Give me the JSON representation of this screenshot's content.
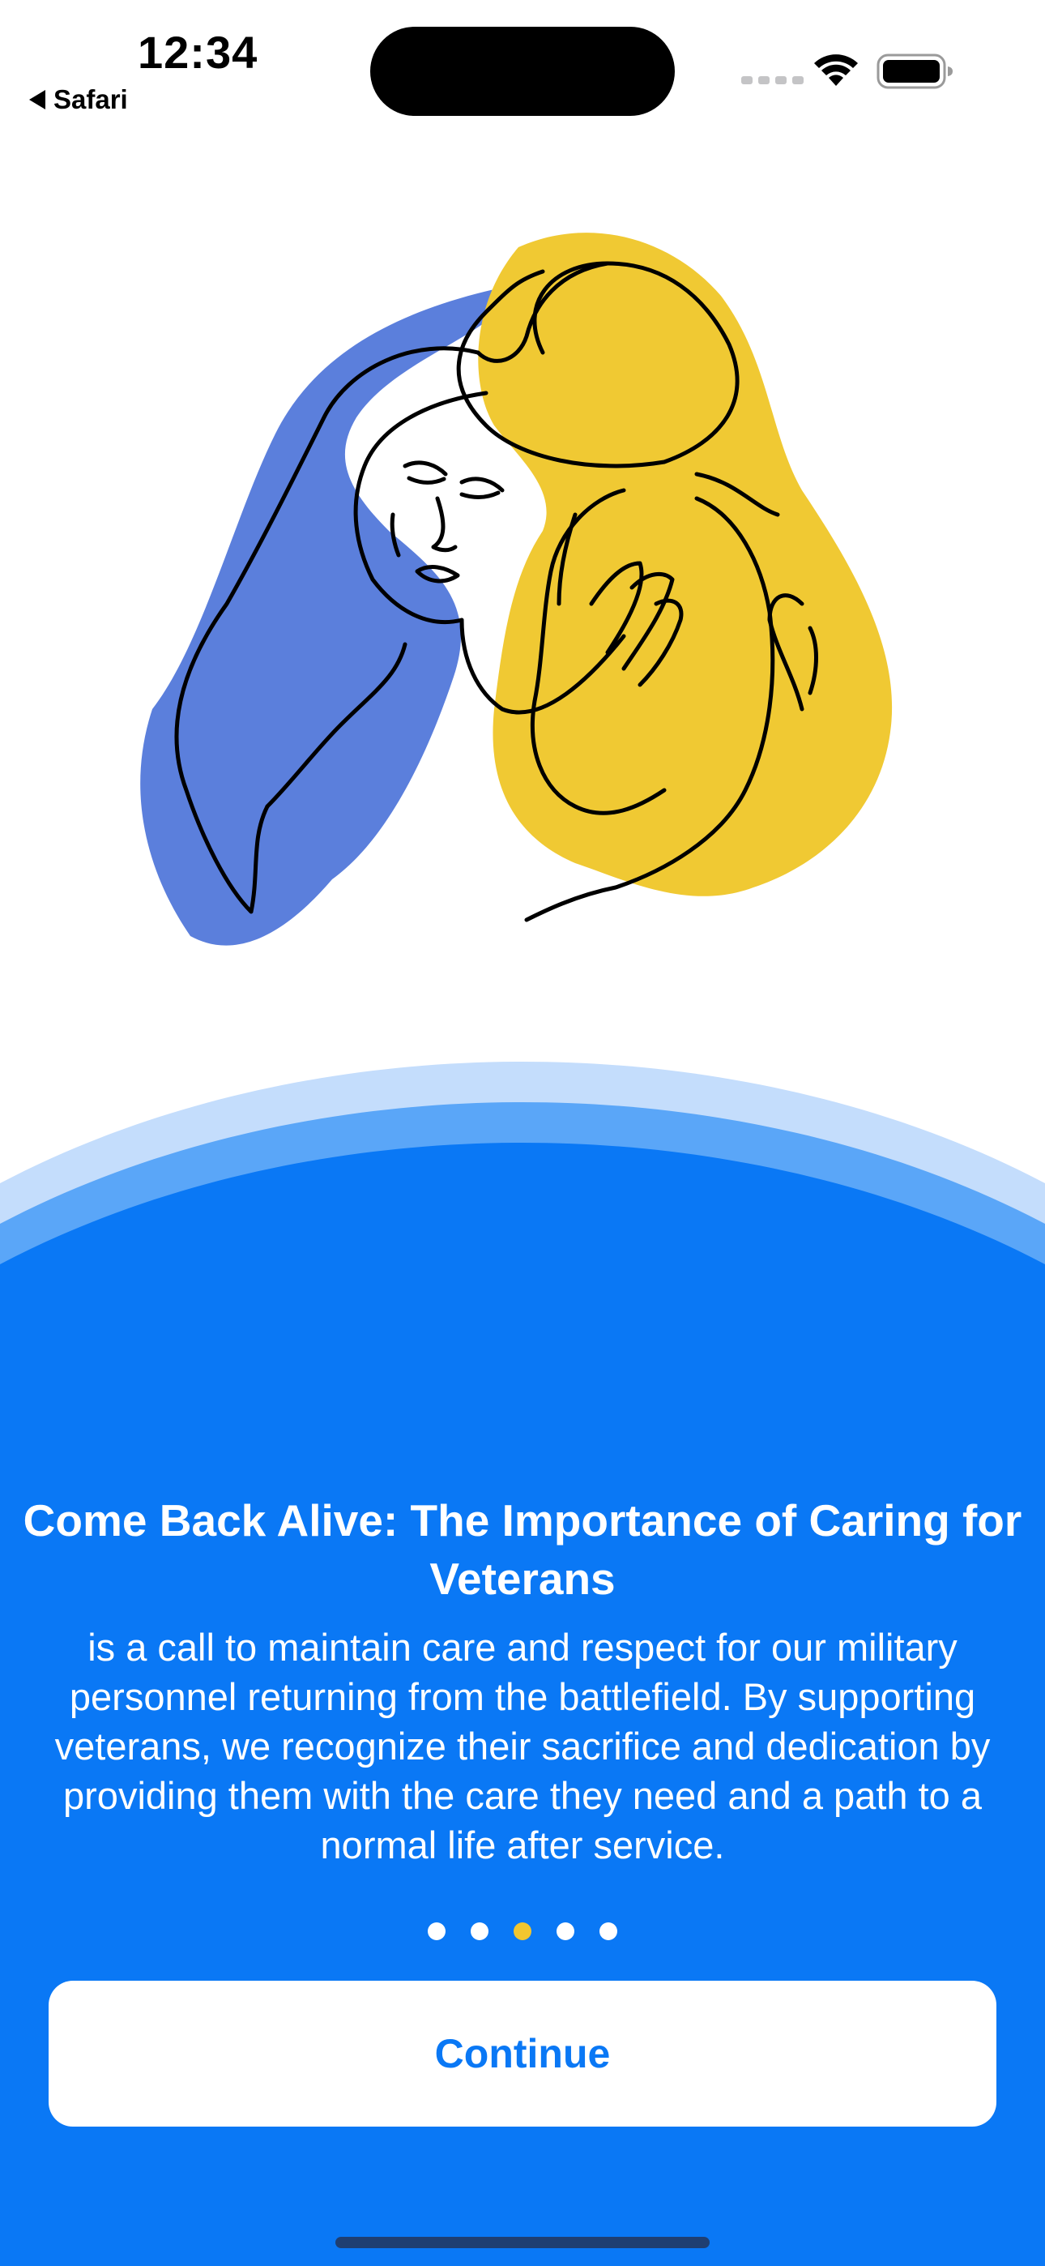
{
  "status_bar": {
    "time": "12:34",
    "back_app_label": "Safari",
    "icons": [
      "signal-icon",
      "wifi-icon",
      "battery-icon"
    ]
  },
  "illustration": {
    "subject": "line-art-embrace",
    "colors": {
      "left_blob": "#5b7fdc",
      "right_blob": "#f0c933",
      "line": "#000000"
    }
  },
  "onboarding": {
    "title": "Come Back Alive: The Importance of Caring for Veterans",
    "description": "is a call to maintain care and respect for our military personnel returning from the battlefield. By supporting veterans, we recognize their sacrifice and dedication by providing them with the care they need and a path to a normal life after service.",
    "page_count": 5,
    "current_page": 3,
    "continue_label": "Continue"
  },
  "colors": {
    "panel_blue": "#0a78f5",
    "arc_light": "#c4ddfc",
    "arc_mid": "#5aa6f8",
    "active_dot": "#f2c62f",
    "button_text": "#0a78f5"
  }
}
